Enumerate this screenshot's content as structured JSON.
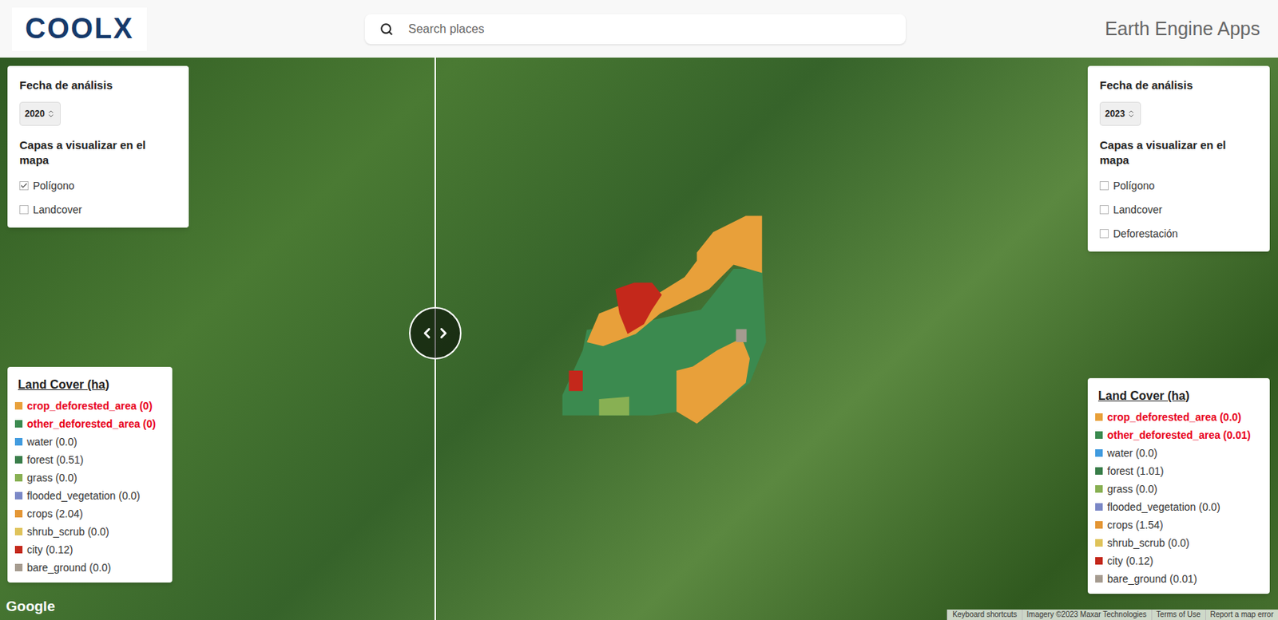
{
  "header": {
    "logo": "COOLX",
    "search": {
      "placeholder": "Search places"
    },
    "title": "Earth Engine Apps"
  },
  "panels": [
    {
      "side": "left",
      "date_label": "Fecha de análisis",
      "year": "2020",
      "layers_label": "Capas a visualizar en el mapa",
      "layers": [
        {
          "label": "Polígono",
          "checked": true
        },
        {
          "label": "Landcover",
          "checked": false
        }
      ],
      "legend": {
        "title": "Land Cover (ha)",
        "items": [
          {
            "label": "crop_deforested_area (0)",
            "color": "#e8a03a",
            "highlighted": true
          },
          {
            "label": "other_deforested_area (0)",
            "color": "#3b8a4f",
            "highlighted": true
          },
          {
            "label": "water (0.0)",
            "color": "#419bdf",
            "highlighted": false
          },
          {
            "label": "forest (0.51)",
            "color": "#397d49",
            "highlighted": false
          },
          {
            "label": "grass (0.0)",
            "color": "#88b053",
            "highlighted": false
          },
          {
            "label": "flooded_vegetation (0.0)",
            "color": "#7a87c6",
            "highlighted": false
          },
          {
            "label": "crops (2.04)",
            "color": "#e49635",
            "highlighted": false
          },
          {
            "label": "shrub_scrub (0.0)",
            "color": "#dfc35a",
            "highlighted": false
          },
          {
            "label": "city (0.12)",
            "color": "#c4281b",
            "highlighted": false
          },
          {
            "label": "bare_ground (0.0)",
            "color": "#a59b8f",
            "highlighted": false
          }
        ]
      }
    },
    {
      "side": "right",
      "date_label": "Fecha de análisis",
      "year": "2023",
      "layers_label": "Capas a visualizar en el mapa",
      "layers": [
        {
          "label": "Polígono",
          "checked": false
        },
        {
          "label": "Landcover",
          "checked": false
        },
        {
          "label": "Deforestación",
          "checked": false
        }
      ],
      "legend": {
        "title": "Land Cover (ha)",
        "items": [
          {
            "label": "crop_deforested_area (0.0)",
            "color": "#e8a03a",
            "highlighted": true
          },
          {
            "label": "other_deforested_area (0.01)",
            "color": "#3b8a4f",
            "highlighted": true
          },
          {
            "label": "water (0.0)",
            "color": "#419bdf",
            "highlighted": false
          },
          {
            "label": "forest (1.01)",
            "color": "#397d49",
            "highlighted": false
          },
          {
            "label": "grass (0.0)",
            "color": "#88b053",
            "highlighted": false
          },
          {
            "label": "flooded_vegetation (0.0)",
            "color": "#7a87c6",
            "highlighted": false
          },
          {
            "label": "crops (1.54)",
            "color": "#e49635",
            "highlighted": false
          },
          {
            "label": "shrub_scrub (0.0)",
            "color": "#dfc35a",
            "highlighted": false
          },
          {
            "label": "city (0.12)",
            "color": "#c4281b",
            "highlighted": false
          },
          {
            "label": "bare_ground (0.01)",
            "color": "#a59b8f",
            "highlighted": false
          }
        ]
      }
    }
  ],
  "map": {
    "google_logo": "Google",
    "attribution": [
      "Keyboard shortcuts",
      "Imagery ©2023 Maxar Technologies",
      "Terms of Use",
      "Report a map error"
    ]
  }
}
